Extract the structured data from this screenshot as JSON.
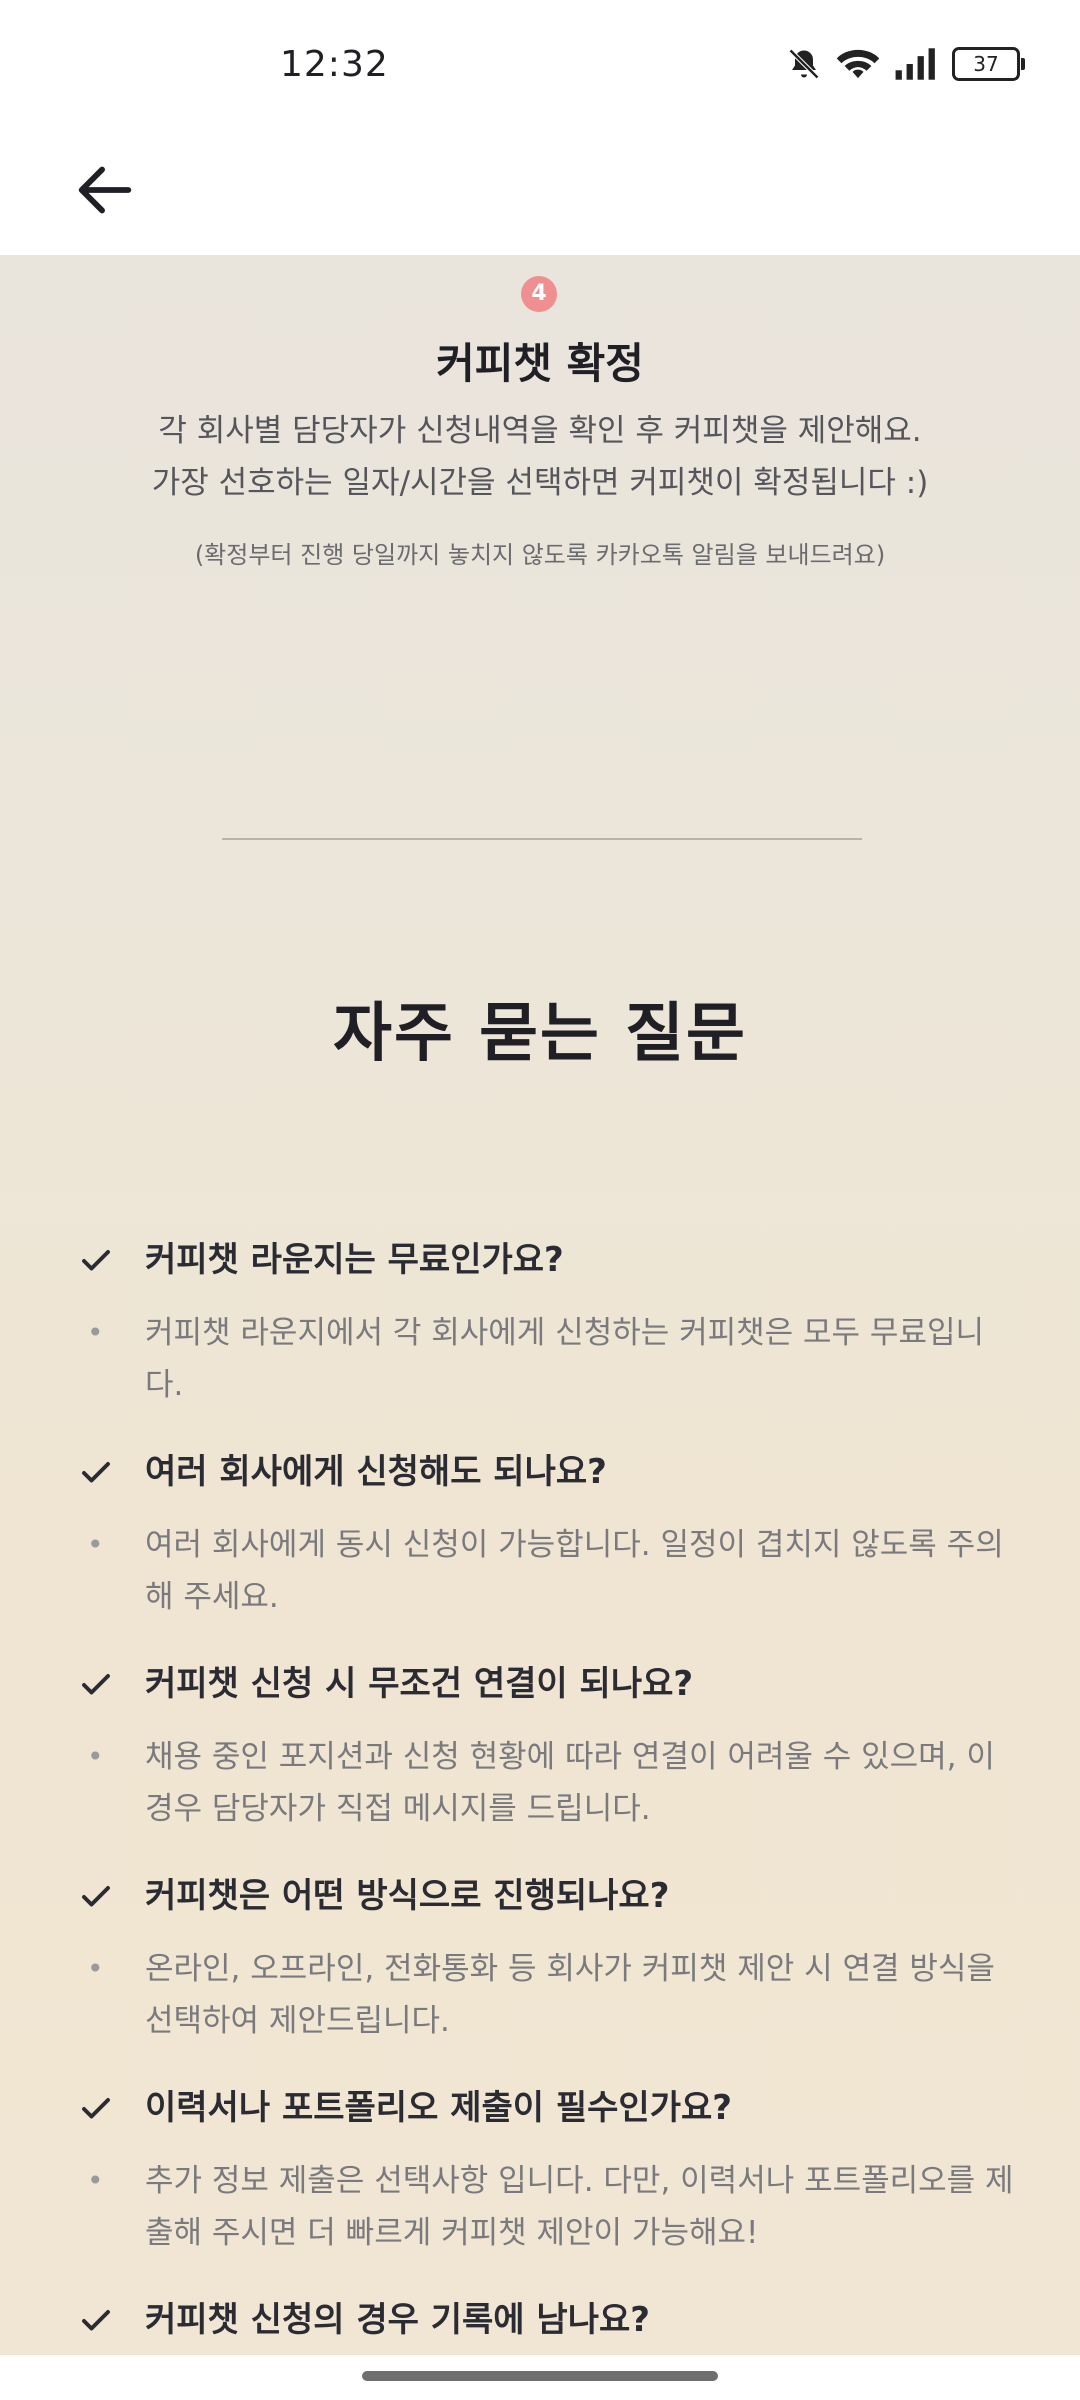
{
  "status_bar": {
    "time": "12:32",
    "battery": "37"
  },
  "step": {
    "number": "4",
    "title": "커피챗 확정",
    "description_line1": "각 회사별 담당자가 신청내역을 확인 후 커피챗을 제안해요.",
    "description_line2": "가장 선호하는 일자/시간을 선택하면 커피챗이 확정됩니다 :)",
    "note": "(확정부터 진행 당일까지 놓치지 않도록 카카오톡 알림을 보내드려요)"
  },
  "faq": {
    "title": "자주 묻는 질문",
    "items": [
      {
        "q": "커피챗 라운지는 무료인가요?",
        "a": "커피챗 라운지에서 각 회사에게 신청하는 커피챗은 모두 무료입니다."
      },
      {
        "q": "여러 회사에게 신청해도 되나요?",
        "a": "여러 회사에게 동시 신청이 가능합니다. 일정이 겹치지 않도록 주의해 주세요."
      },
      {
        "q": "커피챗 신청 시 무조건 연결이 되나요?",
        "a": "채용 중인 포지션과 신청 현황에 따라 연결이 어려울 수 있으며, 이 경우 담당자가 직접 메시지를 드립니다."
      },
      {
        "q": "커피챗은 어떤 방식으로 진행되나요?",
        "a": "온라인, 오프라인, 전화통화 등 회사가 커피챗 제안 시 연결 방식을 선택하여 제안드립니다."
      },
      {
        "q": "이력서나 포트폴리오 제출이 필수인가요?",
        "a": "추가 정보 제출은 선택사항 입니다. 다만, 이력서나 포트폴리오를 제출해 주시면 더 빠르게 커피챗 제안이 가능해요!"
      },
      {
        "q": "커피챗 신청의 경우 기록에 남나요?",
        "a": ""
      }
    ]
  }
}
